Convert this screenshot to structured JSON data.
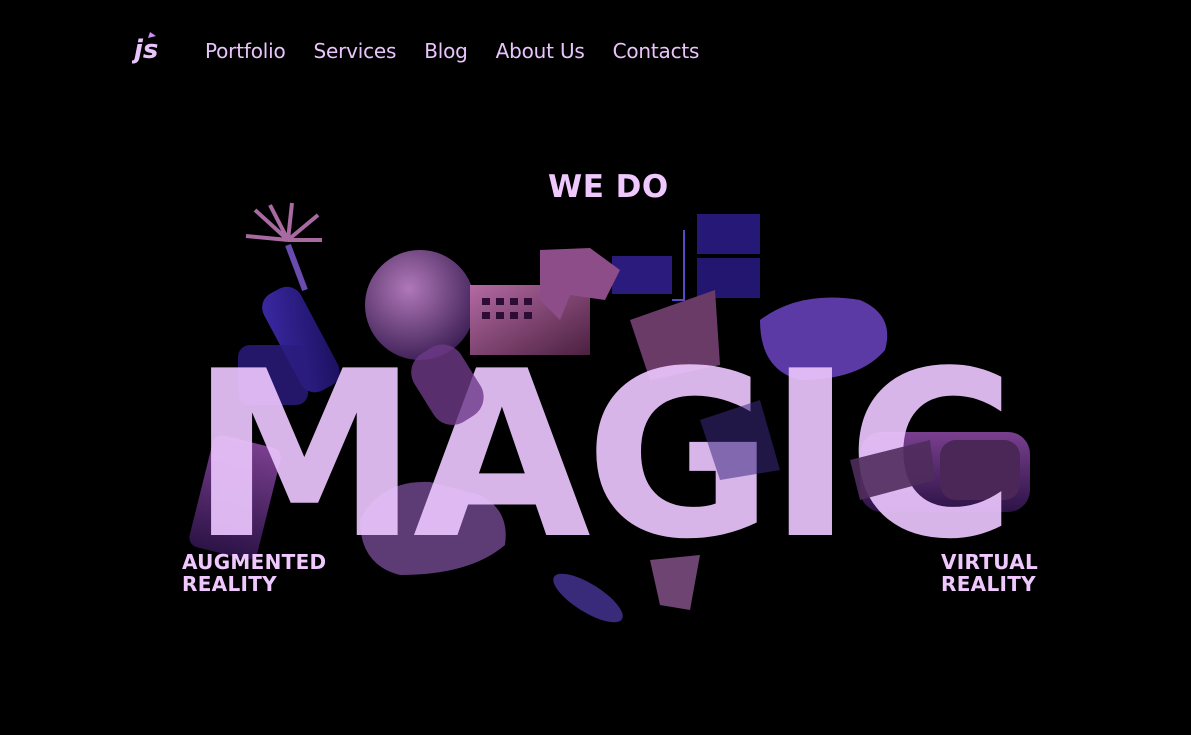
{
  "brand": {
    "logo_icon": "js-logo-icon",
    "accent": "#eecdfc",
    "background": "#000000"
  },
  "nav": {
    "items": [
      {
        "label": "Portfolio"
      },
      {
        "label": "Services"
      },
      {
        "label": "Blog"
      },
      {
        "label": "About Us"
      },
      {
        "label": "Contacts"
      }
    ]
  },
  "hero": {
    "kicker": "WE DO",
    "headline": "MAGIC",
    "left_label": {
      "line1": "AUGMENTED",
      "line2": "REALITY"
    },
    "right_label": {
      "line1": "VIRTUAL",
      "line2": "REALITY"
    }
  }
}
